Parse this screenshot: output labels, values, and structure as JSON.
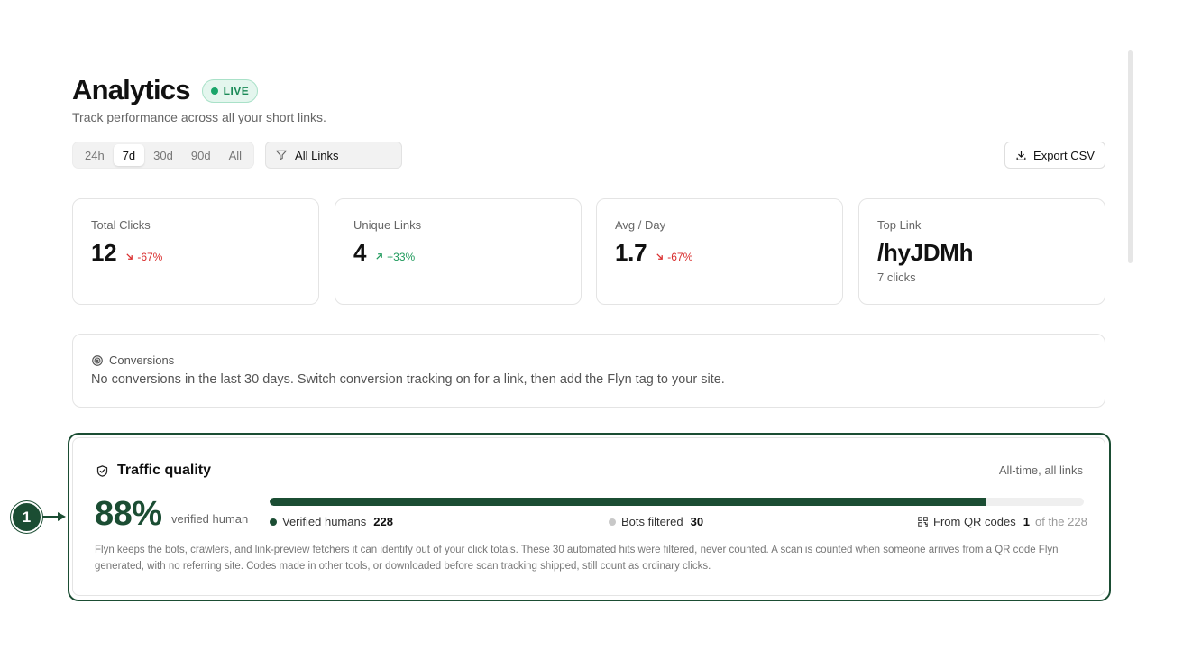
{
  "header": {
    "title": "Analytics",
    "badge": "LIVE",
    "subtitle": "Track performance across all your short links."
  },
  "controls": {
    "ranges": [
      "24h",
      "7d",
      "30d",
      "90d",
      "All"
    ],
    "active_range": "7d",
    "filter_label": "All Links",
    "export_label": "Export CSV"
  },
  "stats": [
    {
      "label": "Total Clicks",
      "value": "12",
      "delta": "-67%",
      "direction": "down"
    },
    {
      "label": "Unique Links",
      "value": "4",
      "delta": "+33%",
      "direction": "up"
    },
    {
      "label": "Avg / Day",
      "value": "1.7",
      "delta": "-67%",
      "direction": "down"
    },
    {
      "label": "Top Link",
      "value": "/hyJDMh",
      "sub": "7 clicks"
    }
  ],
  "conversions": {
    "title": "Conversions",
    "text": "No conversions in the last 30 days. Switch conversion tracking on for a link, then add the Flyn tag to your site."
  },
  "traffic_quality": {
    "title": "Traffic quality",
    "scope": "All-time, all links",
    "percent": "88%",
    "percent_label": "verified human",
    "human_fraction": 0.88,
    "verified_label": "Verified humans",
    "verified_count": "228",
    "bots_label": "Bots filtered",
    "bots_count": "30",
    "qr_label": "From QR codes",
    "qr_count": "1",
    "qr_suffix": "of the 228",
    "description": "Flyn keeps the bots, crawlers, and link-preview fetchers it can identify out of your click totals. These 30 automated hits were filtered, never counted. A scan is counted when someone arrives from a QR code Flyn generated, with no referring site. Codes made in other tools, or downloaded before scan tracking shipped, still count as ordinary clicks."
  },
  "callout": {
    "number": "1"
  },
  "colors": {
    "accent_green": "#1b4d33",
    "live_green": "#1aa56a",
    "delta_down": "#d92d2d",
    "delta_up": "#1f9a5c",
    "bots_gray": "#c8c8c8"
  },
  "icons": {
    "filter": "funnel-icon",
    "export": "download-icon",
    "conversions": "target-icon",
    "traffic": "shield-check-icon",
    "qr": "qr-code-icon",
    "down": "arrow-down-right-icon",
    "up": "arrow-up-right-icon"
  }
}
